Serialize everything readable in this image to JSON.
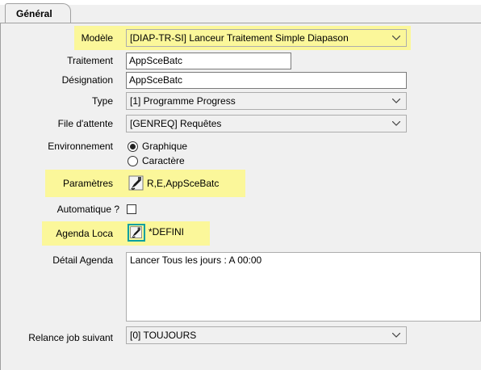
{
  "tabs": [
    {
      "label": "Général",
      "active": true
    }
  ],
  "colors": {
    "highlight": "#fbf79a",
    "focus_border": "#00a0a0",
    "window_bg": "#f0f0f0"
  },
  "fields": {
    "modele": {
      "label": "Modèle",
      "value": "[DIAP-TR-SI] Lanceur Traitement Simple Diapason"
    },
    "traitement": {
      "label": "Traitement",
      "value": "AppSceBatc"
    },
    "designation": {
      "label": "Désignation",
      "value": "AppSceBatc"
    },
    "type": {
      "label": "Type",
      "value": "[1] Programme Progress"
    },
    "file_attente": {
      "label": "File d'attente",
      "value": "[GENREQ] Requêtes"
    },
    "environnement": {
      "label": "Environnement",
      "options": [
        "Graphique",
        "Caractère"
      ],
      "selected": "Graphique"
    },
    "parametres": {
      "label": "Paramètres",
      "value": "R,E,AppSceBatc",
      "icon": "edit-icon"
    },
    "automatique": {
      "label": "Automatique ?",
      "checked": false
    },
    "agenda_loca": {
      "label": "Agenda Loca",
      "value": "*DEFINI",
      "icon": "edit-icon"
    },
    "detail_agenda": {
      "label": "Détail Agenda",
      "value": "Lancer Tous les jours : A 00:00"
    },
    "relance": {
      "label": "Relance job suivant",
      "value": "[0] TOUJOURS"
    }
  }
}
